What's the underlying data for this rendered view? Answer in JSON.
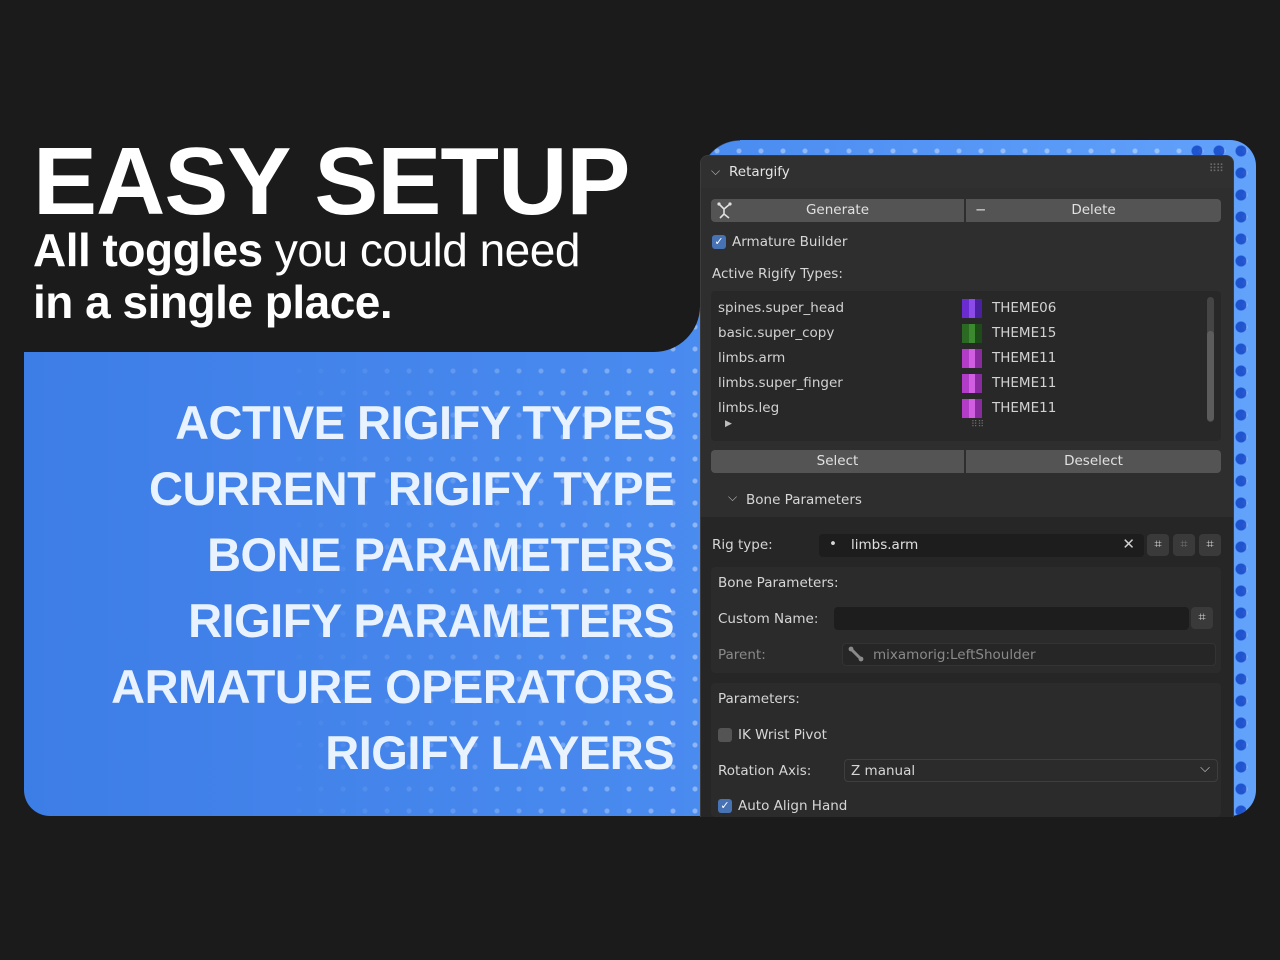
{
  "promo": {
    "headline": "EASY SETUP",
    "tagline_bold": "All toggles",
    "tagline_rest": "you could need",
    "tagline_line2": "in a single place.",
    "features": [
      "ACTIVE RIGIFY TYPES",
      "CURRENT RIGIFY TYPE",
      "BONE PARAMETERS",
      "RIGIFY PARAMETERS",
      "ARMATURE OPERATORS",
      "RIGIFY LAYERS"
    ],
    "colors": {
      "background": "#1b1b1b",
      "accent_blue": "#4a8bf0",
      "text": "#ffffff"
    }
  },
  "panel": {
    "title": "Retargify",
    "collapse_icon": "chevron-down-icon",
    "grip_icon": "drag-grip-icon",
    "generate_icon": "armature-icon",
    "generate_label": "Generate",
    "delete_icon": "minus-icon",
    "delete_label": "Delete",
    "armature_builder_label": "Armature Builder",
    "armature_builder_checked": true,
    "active_types_label": "Active Rigify Types:",
    "rigify_types": [
      {
        "name": "spines.super_head",
        "theme": "THEME06",
        "colors": [
          "#6a2bd1",
          "#8a4be8",
          "#4a1fa0"
        ]
      },
      {
        "name": "basic.super_copy",
        "theme": "THEME15",
        "colors": [
          "#2a6a22",
          "#3c8a30",
          "#1e4c18"
        ]
      },
      {
        "name": "limbs.arm",
        "theme": "THEME11",
        "colors": [
          "#b23bc8",
          "#d05ee0",
          "#8a2aa0"
        ]
      },
      {
        "name": "limbs.super_finger",
        "theme": "THEME11",
        "colors": [
          "#b23bc8",
          "#d05ee0",
          "#8a2aa0"
        ]
      },
      {
        "name": "limbs.leg",
        "theme": "THEME11",
        "colors": [
          "#b23bc8",
          "#d05ee0",
          "#8a2aa0"
        ]
      }
    ],
    "expand_icon": "triangle-right-icon",
    "select_label": "Select",
    "deselect_label": "Deselect",
    "bone_params_section": "Bone Parameters",
    "rig_type_label": "Rig type:",
    "rig_type_value": "limbs.arm",
    "clear_icon": "close-icon",
    "bone_params_label": "Bone Parameters:",
    "custom_name_label": "Custom Name:",
    "custom_name_value": "",
    "parent_label": "Parent:",
    "parent_value": "mixamorig:LeftShoulder",
    "parent_icon": "bone-icon",
    "parameters_label": "Parameters:",
    "ik_wrist_label": "IK Wrist Pivot",
    "ik_wrist_checked": false,
    "rotation_axis_label": "Rotation Axis:",
    "rotation_axis_value": "Z manual",
    "auto_align_label": "Auto Align Hand",
    "auto_align_checked": true,
    "colors": {
      "panel_bg": "#2e2e2e",
      "checkbox_on": "#4772b3",
      "button": "#545454"
    }
  }
}
